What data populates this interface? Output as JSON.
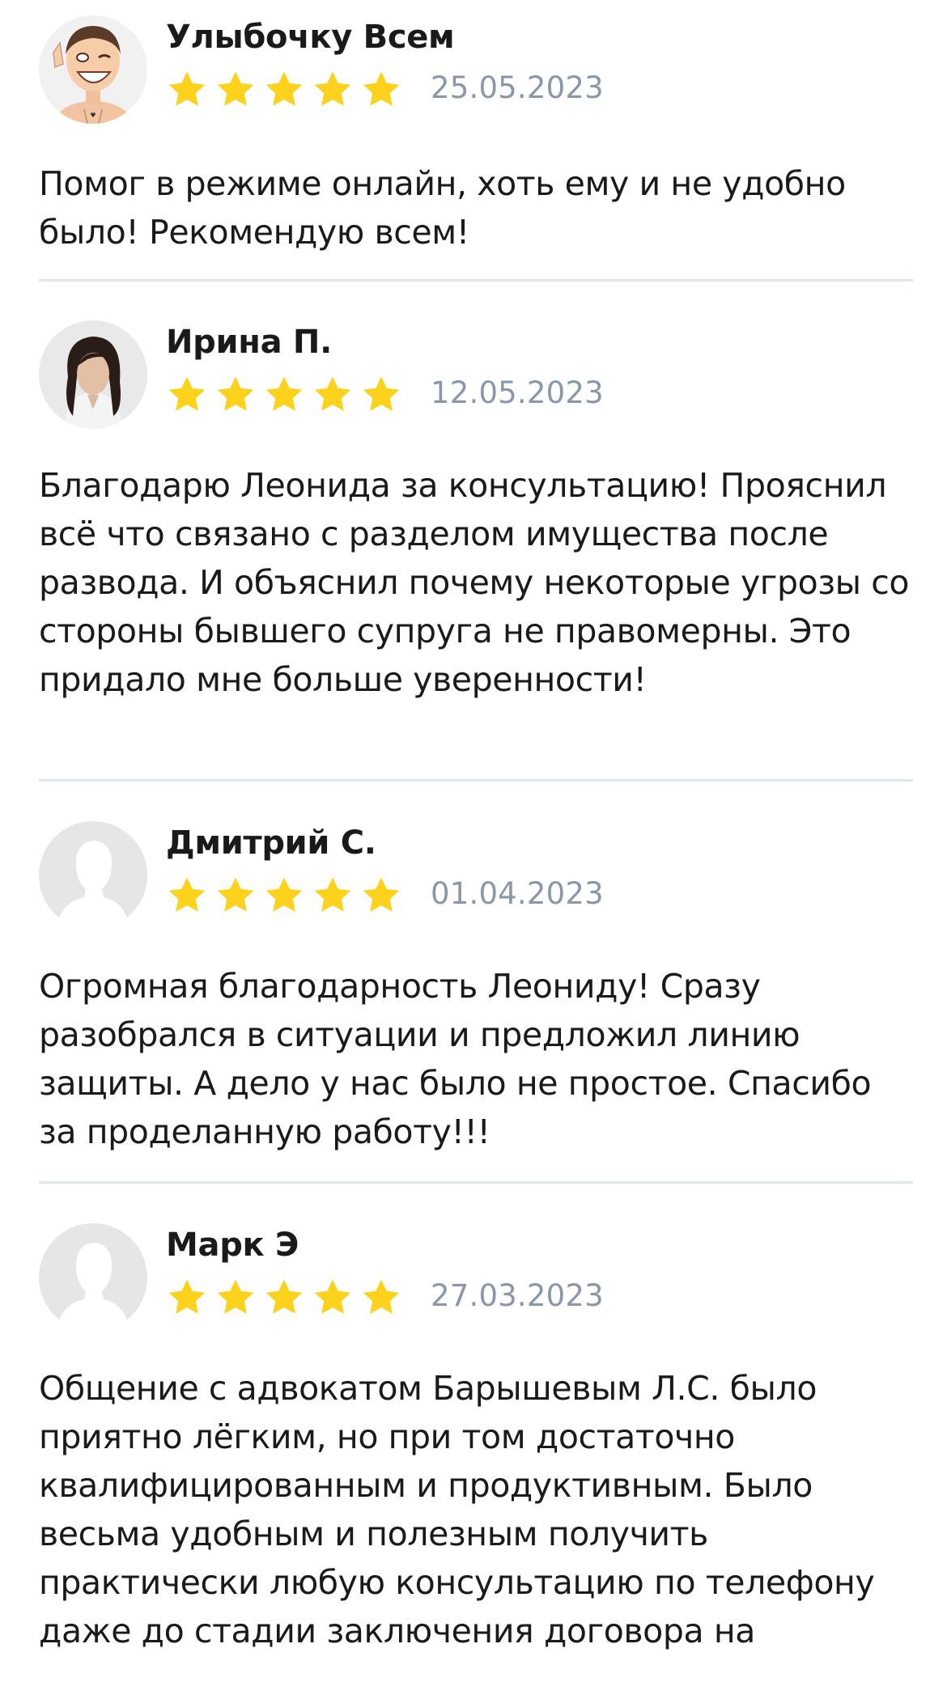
{
  "reviews": [
    {
      "author": "Улыбочку Всем",
      "rating": 5,
      "date": "25.05.2023",
      "avatar": "cartoon-avatar",
      "text": "Помог в режиме онлайн, хоть ему и не удобно было! Рекомендую всем!"
    },
    {
      "author": "Ирина П.",
      "rating": 5,
      "date": "12.05.2023",
      "avatar": "photo-avatar",
      "text": "Благодарю Леонида за консультацию! Прояснил всё что связано с разделом имущества после развода. И объяснил почему некоторые угрозы со стороны бывшего супруга не правомерны. Это придало мне больше уверенности!"
    },
    {
      "author": "Дмитрий С.",
      "rating": 5,
      "date": "01.04.2023",
      "avatar": "default-user-avatar",
      "text": "Огромная благодарность Леониду! Сразу разобрался в ситуации и предложил линию защиты. А дело у нас было не простое. Спасибо за проделанную работу!!!"
    },
    {
      "author": "Марк Э",
      "rating": 5,
      "date": "27.03.2023",
      "avatar": "default-user-avatar",
      "text": "Общение с адвокатом Барышевым Л.С. было приятно лёгким, но при том достаточно квалифицированным и продуктивным. Было весьма удобным и полезным получить практически любую консультацию по телефону даже до стадии заключения договора на"
    }
  ],
  "colors": {
    "star": "#fcd21d",
    "date": "#8a97a8",
    "divider": "#dde6ea",
    "text": "#1a1a1a"
  },
  "icons": {
    "star": "star-icon",
    "default_avatar": "user-silhouette-icon"
  }
}
